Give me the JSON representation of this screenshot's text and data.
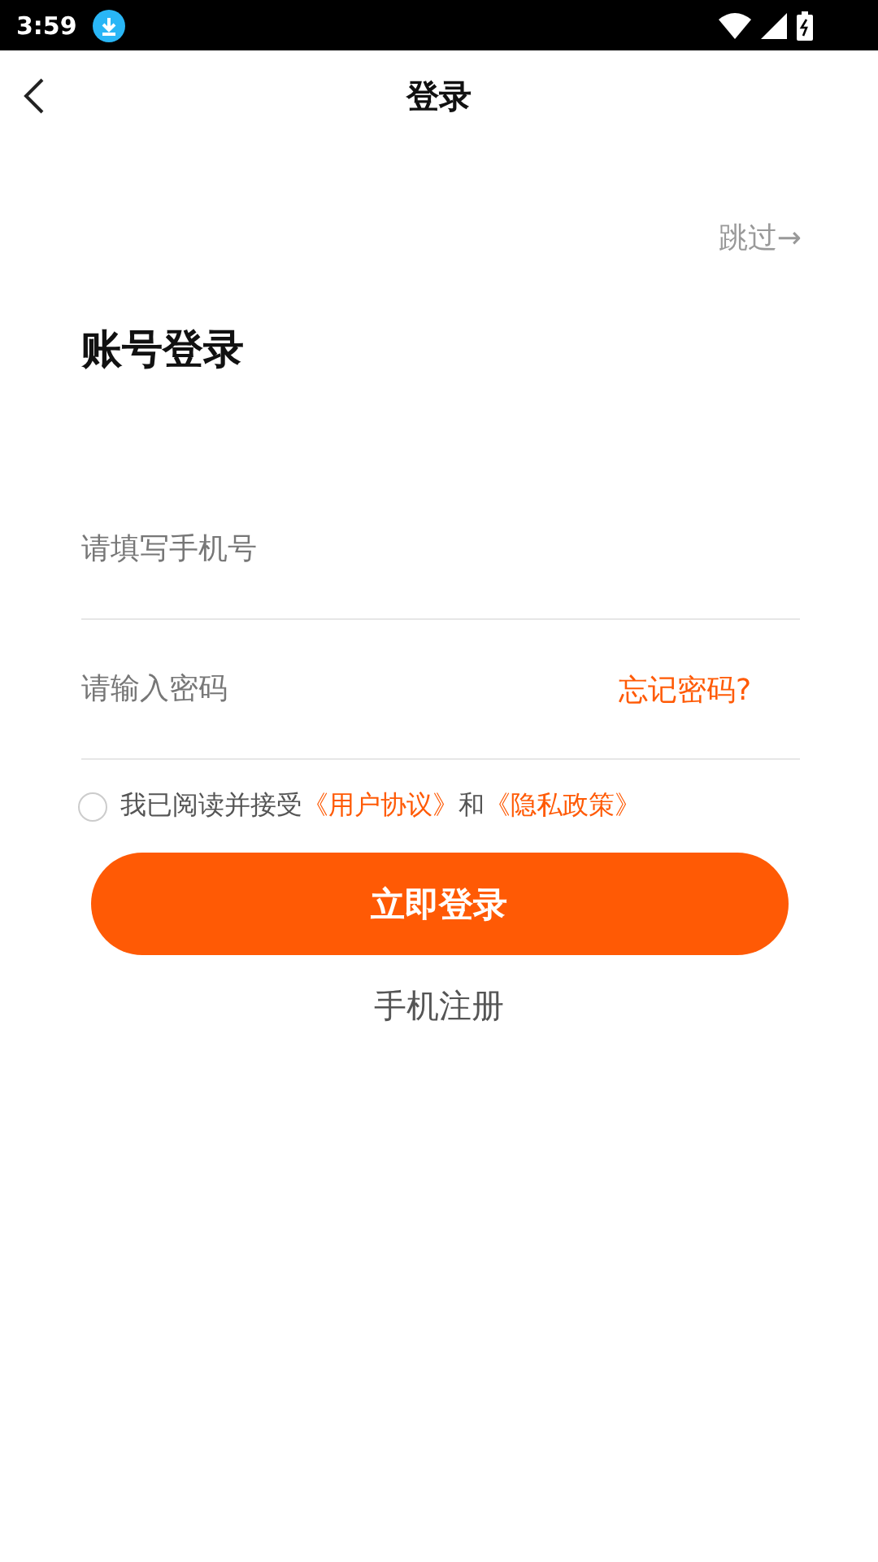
{
  "status_bar": {
    "time": "3:59"
  },
  "header": {
    "title": "登录"
  },
  "skip": "跳过→",
  "heading": "账号登录",
  "fields": [
    {
      "placeholder": "请填写手机号"
    },
    {
      "placeholder": "请输入密码",
      "action": "忘记密码?"
    }
  ],
  "agreement": {
    "checked": false,
    "parts": [
      {
        "kind": "text",
        "text": "我已阅读并接受"
      },
      {
        "kind": "link",
        "text": "《用户协议》"
      },
      {
        "kind": "text",
        "text": "和"
      },
      {
        "kind": "link",
        "text": "《隐私政策》"
      }
    ]
  },
  "login_button": "立即登录",
  "register": "手机注册"
}
